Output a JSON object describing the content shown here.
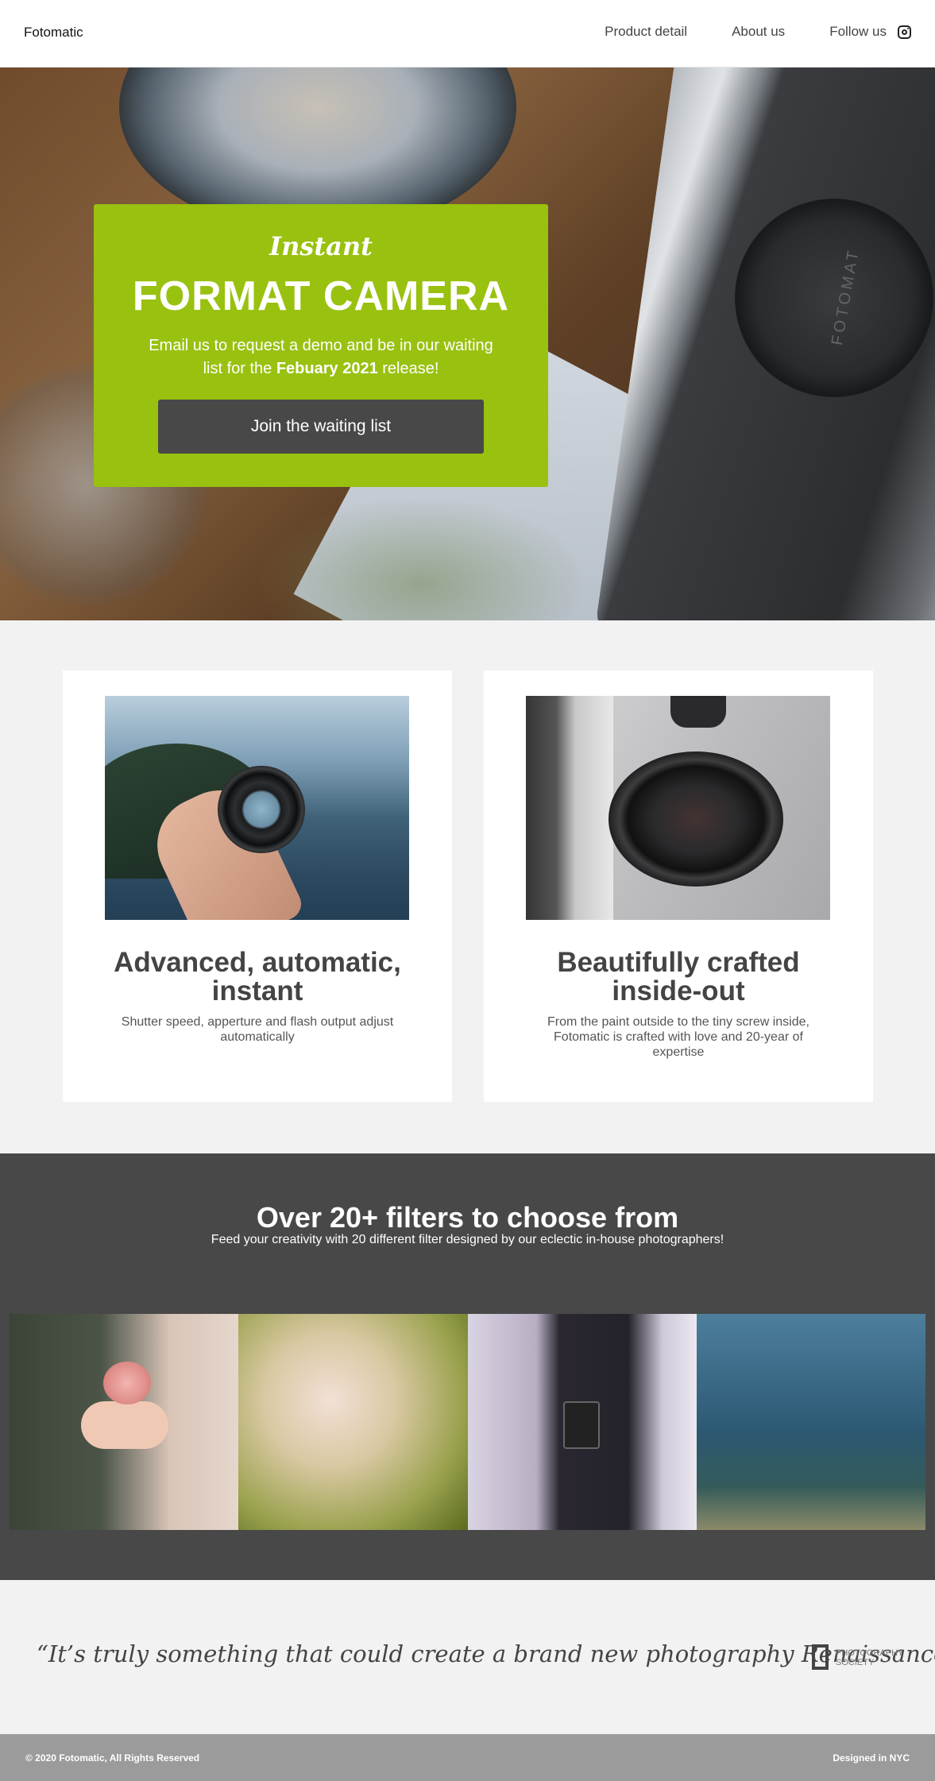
{
  "nav": {
    "brand": "Fotomatic",
    "links": [
      "Product detail",
      "About us",
      "Follow us"
    ],
    "social_icon": "instagram-icon"
  },
  "hero": {
    "script_title": "Instant",
    "title": "FORMAT CAMERA",
    "text_before": "Email us to request a demo and be in our waiting list for the ",
    "text_bold": "Febuary 2021",
    "text_after": " release!",
    "button": "Join the waiting list",
    "card_color": "#99c10f",
    "button_color": "#484848"
  },
  "features": [
    {
      "title": "Advanced, automatic, instant",
      "text": "Shutter speed, apperture and flash output adjust automatically"
    },
    {
      "title": "Beautifully crafted inside-out",
      "text": "From the paint outside to the tiny screw inside, Fotomatic is crafted with love and 20-year of expertise"
    }
  ],
  "filters": {
    "title": "Over 20+ filters to choose from",
    "subtitle": "Feed your creativity with 20 different filter designed by our eclectic in-house photographers!",
    "background": "#484848"
  },
  "quote": {
    "text": "“It’s truly something that could create a brand new photography Renaissance”",
    "logo_line1": "PHOTOGRAPHY",
    "logo_line2": "SOCIETY"
  },
  "footer": {
    "left": "© 2020 Fotomatic, All Rights Reserved",
    "right": "Designed in NYC",
    "background": "#9b9b9b"
  }
}
